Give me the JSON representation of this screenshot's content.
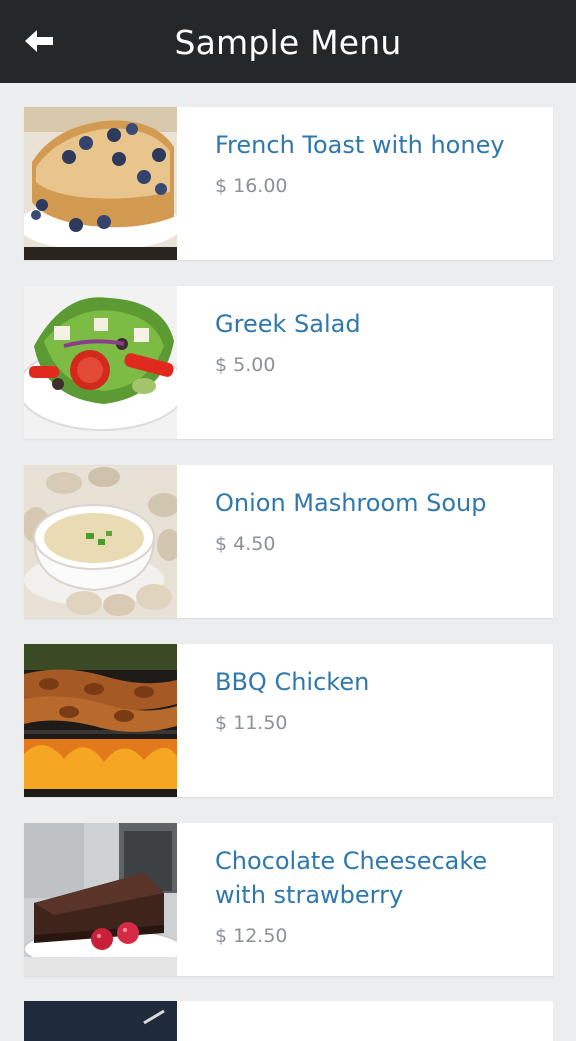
{
  "header": {
    "title": "Sample Menu",
    "back_icon": "arrow-left-icon",
    "background": "#24282b"
  },
  "menu": {
    "items": [
      {
        "name": "French Toast with honey",
        "price": "$ 16.00"
      },
      {
        "name": "Greek Salad",
        "price": "$ 5.00"
      },
      {
        "name": "Onion Mashroom Soup",
        "price": "$ 4.50"
      },
      {
        "name": "BBQ Chicken",
        "price": "$ 11.50"
      },
      {
        "name": "Chocolate Cheesecake with strawberry",
        "price": "$ 12.50"
      }
    ]
  },
  "colors": {
    "item_name": "#2f78ad",
    "price": "#8c9196",
    "background": "#ecedef"
  }
}
